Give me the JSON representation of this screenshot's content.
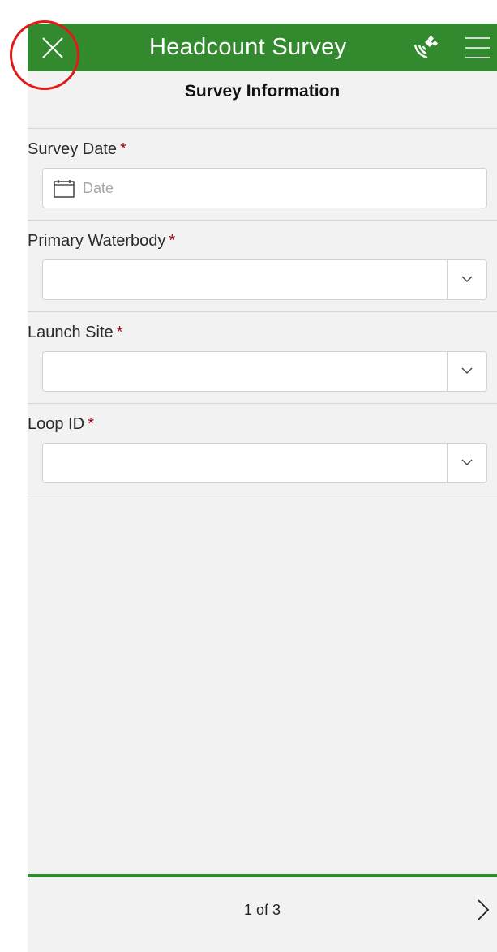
{
  "header": {
    "title": "Headcount Survey",
    "close_icon": "close-icon",
    "gps_icon": "satellite-gps-icon",
    "menu_icon": "hamburger-menu-icon",
    "background_color": "#338a2e"
  },
  "section": {
    "title": "Survey Information"
  },
  "fields": {
    "survey_date": {
      "label": "Survey Date",
      "required_marker": "*",
      "placeholder": "Date",
      "icon": "calendar-icon"
    },
    "primary_waterbody": {
      "label": "Primary Waterbody",
      "required_marker": "*",
      "value": ""
    },
    "launch_site": {
      "label": "Launch Site",
      "required_marker": "*",
      "value": ""
    },
    "loop_id": {
      "label": "Loop ID",
      "required_marker": "*",
      "value": ""
    }
  },
  "footer": {
    "page_indicator": "1 of 3",
    "next_icon": "chevron-right-icon"
  },
  "colors": {
    "accent": "#338a2e",
    "required": "#a8071a",
    "annotation_ring": "#e01919"
  }
}
